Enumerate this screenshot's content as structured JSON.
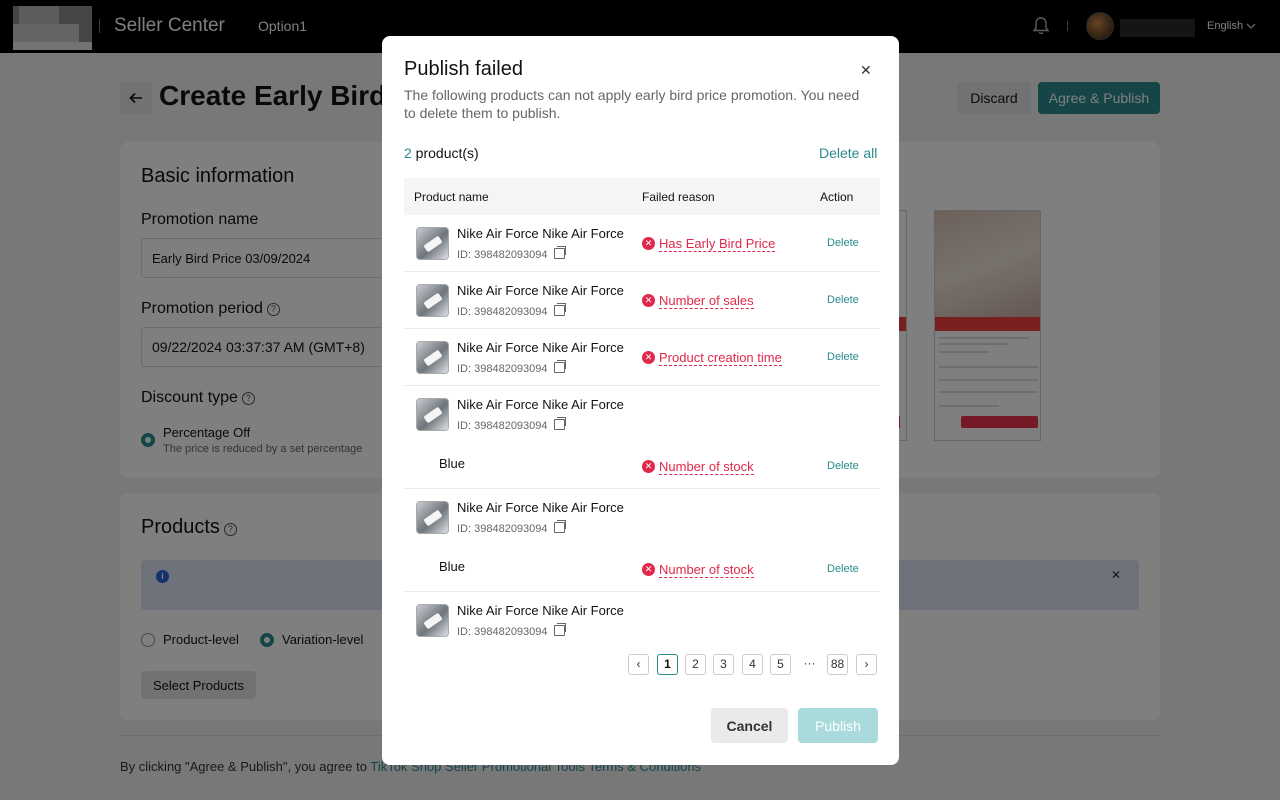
{
  "topbar": {
    "brand": "Seller Center",
    "nav_option": "Option1",
    "language": "English"
  },
  "page": {
    "title": "Create Early Bird P",
    "discard_label": "Discard",
    "agree_label": "Agree & Publish"
  },
  "basic": {
    "section_title": "Basic information",
    "promotion_name_label": "Promotion name",
    "promotion_name_value": "Early Bird Price 03/09/2024",
    "promotion_period_label": "Promotion period",
    "promotion_period_value": "09/22/2024 03:37:37 AM (GMT+8)",
    "discount_type_label": "Discount type",
    "discount_option_label": "Percentage Off",
    "discount_option_desc": "The price is reduced by a set percentage"
  },
  "products": {
    "section_title": "Products",
    "level_options": [
      "Product-level",
      "Variation-level"
    ],
    "select_label": "Select Products"
  },
  "footer": {
    "prefix": "By clicking \"Agree & Publish\", you agree to ",
    "link": "TikTok Shop Seller Promotional Tools Terms & Conditions"
  },
  "modal": {
    "title": "Publish failed",
    "description": "The following products can not apply early bird price promotion. You need to delete them to publish.",
    "count_num": "2",
    "count_suffix": " product(s)",
    "delete_all": "Delete all",
    "headers": {
      "name": "Product name",
      "reason": "Failed reason",
      "action": "Action"
    },
    "rows": [
      {
        "name": "Nike Air Force Nike Air Force",
        "id": "ID: 398482093094",
        "reason": "Has Early Bird Price",
        "action": "Delete"
      },
      {
        "name": "Nike Air Force Nike Air Force",
        "id": "ID: 398482093094",
        "reason": "Number of sales",
        "action": "Delete"
      },
      {
        "name": "Nike Air Force Nike Air Force",
        "id": "ID: 398482093094",
        "reason": "Product creation time",
        "action": "Delete"
      },
      {
        "name": "Nike Air Force Nike Air Force",
        "id": "ID: 398482093094",
        "variation": "Blue",
        "reason": "Number of stock",
        "action": "Delete"
      },
      {
        "name": "Nike Air Force Nike Air Force",
        "id": "ID: 398482093094",
        "variation": "Blue",
        "reason": "Number of stock",
        "action": "Delete"
      },
      {
        "name": "Nike Air Force Nike Air Force",
        "id": "ID: 398482093094"
      }
    ],
    "pagination": [
      "1",
      "2",
      "3",
      "4",
      "5",
      "···",
      "88"
    ],
    "cancel_label": "Cancel",
    "publish_label": "Publish"
  },
  "icons": {
    "back": "arrow-left-icon",
    "bell": "bell-icon",
    "close": "close-icon",
    "help": "question-circle-icon",
    "info": "info-icon",
    "copy": "copy-icon",
    "error": "error-circle-icon"
  },
  "colors": {
    "accent": "#2b8a8c",
    "error": "#e0294a",
    "info_bg": "#dbe5f7"
  }
}
